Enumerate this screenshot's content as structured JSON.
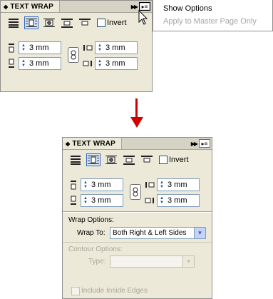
{
  "panel": {
    "title": "TEXT WRAP",
    "invert_label": "Invert",
    "offsets": {
      "top": "3 mm",
      "bottom": "3 mm",
      "left": "3 mm",
      "right": "3 mm"
    }
  },
  "menu": {
    "show_options": "Show Options",
    "apply_master": "Apply to Master Page Only"
  },
  "options": {
    "wrap_options_label": "Wrap Options:",
    "wrap_to_label": "Wrap To:",
    "wrap_to_value": "Both Right & Left Sides",
    "contour_options_label": "Contour Options:",
    "type_label": "Type:",
    "type_value": "",
    "include_inside_edges": "Include Inside Edges"
  },
  "colors": {
    "panel_bg": "#ece9d8",
    "arrow": "#d00000",
    "accent": "#316ac5"
  },
  "icons": [
    "no-wrap-icon",
    "wrap-bounding-box-icon",
    "wrap-object-shape-icon",
    "jump-object-icon",
    "jump-next-column-icon"
  ]
}
